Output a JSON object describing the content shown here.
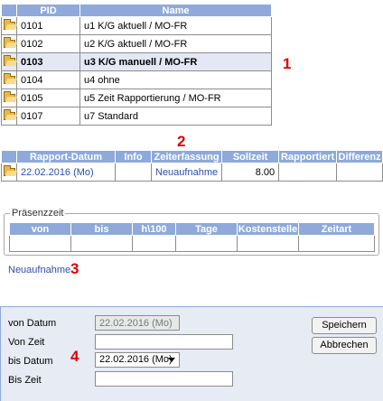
{
  "pid_table": {
    "headers": [
      "PID",
      "Name"
    ],
    "rows": [
      {
        "pid": "0101",
        "name": "u1 K/G aktuell / MO-FR"
      },
      {
        "pid": "0102",
        "name": "u2 K/G aktuell / MO-FR"
      },
      {
        "pid": "0103",
        "name": "u3 K/G manuell / MO-FR"
      },
      {
        "pid": "0104",
        "name": "u4 ohne"
      },
      {
        "pid": "0105",
        "name": "u5 Zeit Rapportierung / MO-FR"
      },
      {
        "pid": "0107",
        "name": "u7 Standard"
      }
    ]
  },
  "rapport_table": {
    "headers": [
      "Rapport-Datum",
      "Info",
      "Zeiterfassung",
      "Sollzeit",
      "Rapportiert",
      "Differenz"
    ],
    "row": {
      "datum": "22.02.2016 (Mo)",
      "info": "",
      "zeiterfassung": "Neuaufnahme",
      "sollzeit": "8.00",
      "rapportiert": "",
      "differenz": ""
    }
  },
  "praesenzzeit": {
    "legend": "Präsenzzeit",
    "headers": [
      "von",
      "bis",
      "h\\100",
      "Tage",
      "Kostenstelle",
      "Zeitart"
    ]
  },
  "neuaufnahme_link": "Neuaufnahme",
  "form": {
    "von_datum_label": "von Datum",
    "von_datum_value": "22.02.2016 (Mo)",
    "von_zeit_label": "Von Zeit",
    "von_zeit_value": "",
    "bis_datum_label": "bis Datum",
    "bis_datum_value": "22.02.2016 (Mo)",
    "bis_zeit_label": "Bis Zeit",
    "bis_zeit_value": "",
    "save_label": "Speichern",
    "cancel_label": "Abbrechen"
  },
  "markers": [
    "1",
    "2",
    "3",
    "4"
  ],
  "colors": {
    "header_bg": "#8ea9da",
    "link": "#2b4fa8",
    "marker": "#e00000",
    "panel_bg": "#e6ebf4"
  }
}
